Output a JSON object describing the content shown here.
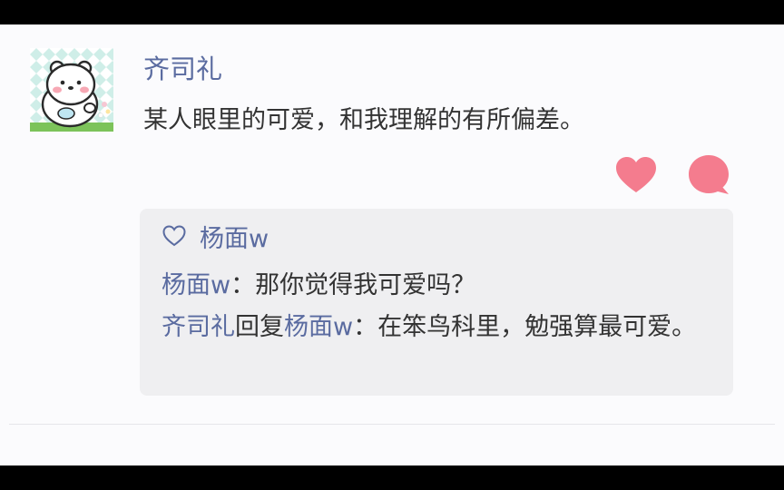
{
  "post": {
    "author": "齐司礼",
    "text": "某人眼里的可爱，和我理解的有所偏差。"
  },
  "actions": {
    "like_icon": "heart-filled-icon",
    "comment_icon": "speech-bubble-icon",
    "accent_color": "#f47c8e"
  },
  "comments": {
    "liked_by": "杨面w",
    "items": [
      {
        "author": "杨面w",
        "separator": "：",
        "text": "那你觉得我可爱吗？"
      },
      {
        "author": "齐司礼",
        "reply_word": "回复",
        "reply_to": "杨面w",
        "separator": "：",
        "text": "在笨鸟科里，勉强算最可爱。"
      }
    ]
  },
  "colors": {
    "name_color": "#5a6ba0",
    "text_color": "#333333",
    "comment_bg": "#efeff1"
  }
}
